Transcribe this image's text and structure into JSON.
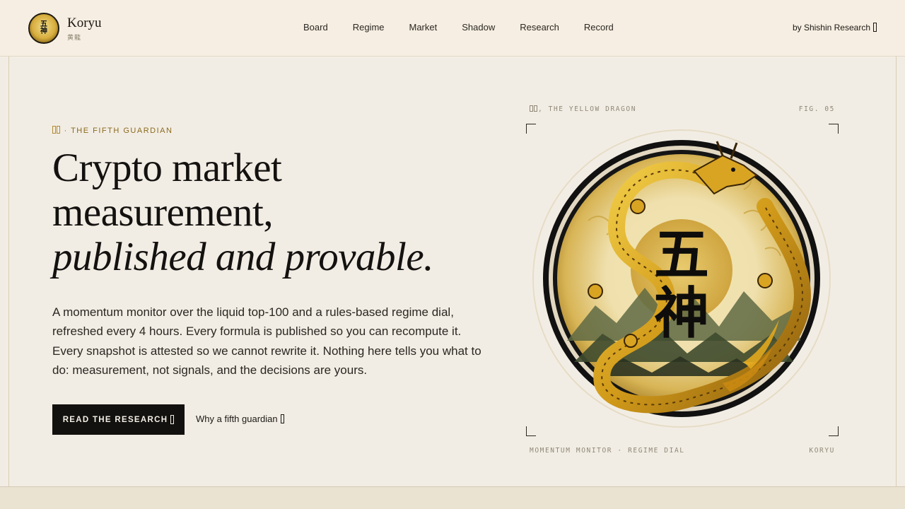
{
  "header": {
    "logo_chars": "五神",
    "brand": "Koryu",
    "brand_sub": "黄龍",
    "nav": [
      "Board",
      "Regime",
      "Market",
      "Shadow",
      "Research",
      "Record"
    ],
    "byline": "by Shishin Research"
  },
  "hero": {
    "eyebrow": "· THE FIFTH GUARDIAN",
    "headline_line1": "Crypto market",
    "headline_line2": "measurement,",
    "headline_italic": "published and provable.",
    "lede": "A momentum monitor over the liquid top-100 and a rules-based regime dial, refreshed every 4 hours. Every formula is published so you can recompute it. Every snapshot is attested so we cannot rewrite it. Nothing here tells you what to do: measurement, not signals, and the decisions are yours.",
    "primary_button": "READ THE RESEARCH",
    "secondary_link": "Why a fifth guardian"
  },
  "figure": {
    "top_left": ", THE YELLOW DRAGON",
    "top_right": "FIG. 05",
    "bottom_left": "MOMENTUM MONITOR · REGIME DIAL",
    "bottom_right": "KORYU",
    "emblem_chars": [
      "五",
      "神"
    ]
  },
  "icons": {
    "logo": "five-gods-seal-icon",
    "arrow": "arrow-glyph-icon",
    "emblem": "yellow-dragon-emblem-icon"
  },
  "colors": {
    "background": "#f2ede4",
    "header_bg": "#f6eee2",
    "accent_gold": "#8a6a1e",
    "button_bg": "#12110f"
  }
}
